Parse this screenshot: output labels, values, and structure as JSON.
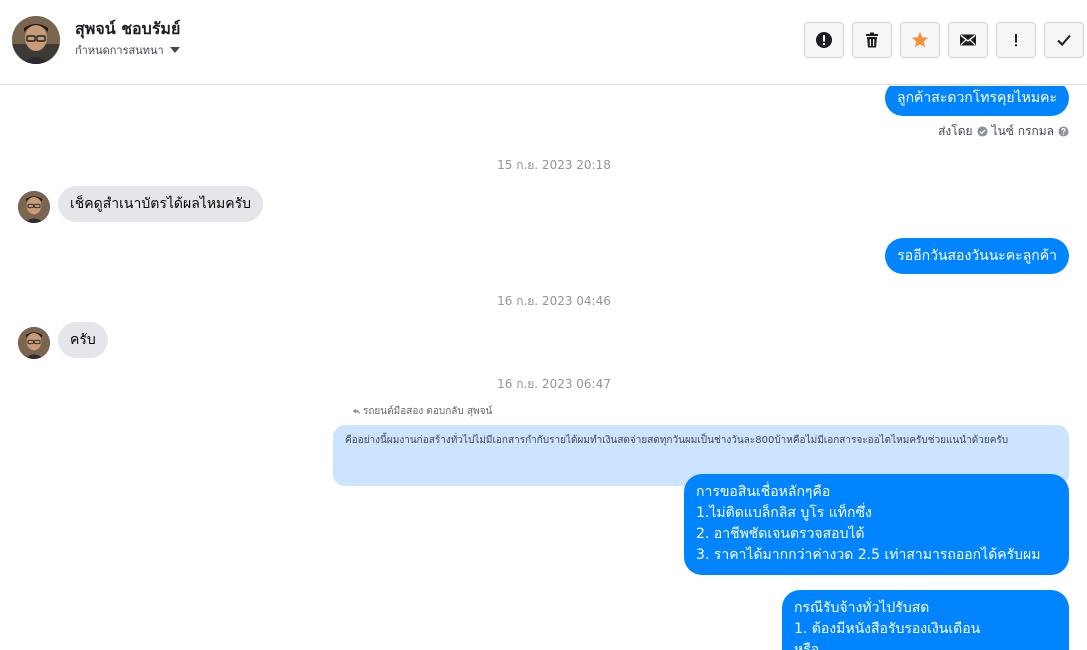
{
  "header": {
    "contact_name": "สุพจน์ ชอบรัมย์",
    "conversation_setting": "กำหนดการสนทนา",
    "actions": [
      {
        "name": "report-icon"
      },
      {
        "name": "trash-icon"
      },
      {
        "name": "star-icon",
        "color": "#f7923b"
      },
      {
        "name": "mail-icon"
      },
      {
        "name": "exclamation-icon"
      },
      {
        "name": "check-icon"
      }
    ]
  },
  "messages": {
    "m1": "ลูกค้าสะดวกโทรคุยไหมคะ",
    "sent_by_prefix": "ส่งโดย",
    "sent_by_name": "ไนซ์ กรกมล",
    "ts1": "15 ก.ย. 2023 20:18",
    "m2": "เช็คดูสำเนาบัตรได้ผลไหมครับ",
    "m3": "รออีกวันสองวันนะคะลูกค้า",
    "ts2": "16 ก.ย. 2023 04:46",
    "m4": "ครับ",
    "ts3": "16 ก.ย. 2023 06:47",
    "reply_label": "รถยนต์มือสอง ตอบกลับ สุพจน์",
    "quoted": "คืออย่างนี้ผมงานก่อสร้างทั่วไปไม่มีเอกสารกำกับรายได้ผมทำเงินสดจ่ายสดทุกวันผมเป็นช่างวันละ800บ้าหคือไม่มีเอกสารจะออไดไหมครับช่วยแนนำด้วยครับ",
    "m5": [
      "การขอสินเชื่อหลักๆคือ",
      "1.ไม่ติดแบล็กลิส บูโร แท็กซึ่ง",
      "2. อาชีพชัดเจนตรวจสอบได้",
      "3. ราคาได้มากกว่าค่างวด 2.5 เท่าสามารถออกได้ครับผม"
    ],
    "m6": [
      "กรณีรับจ้างทั่วไปรับสด",
      "1. ต้องมีหนังสือรับรองเงินเดือน",
      "หรือ"
    ]
  },
  "colors": {
    "outgoing": "#0084ff",
    "incoming": "#e4e6eb",
    "quoted": "#cce4ff"
  }
}
